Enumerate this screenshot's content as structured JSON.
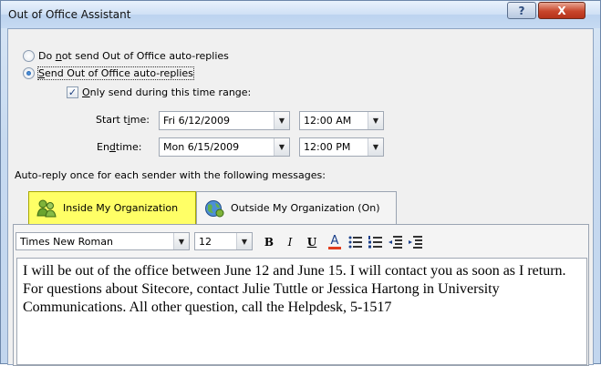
{
  "window": {
    "title": "Out of Office Assistant",
    "help_label": "?",
    "close_label": "X"
  },
  "options": {
    "do_not_send": {
      "pre": "Do ",
      "hot": "n",
      "post": "ot send Out of Office auto-replies",
      "selected": false
    },
    "send": {
      "pre": "",
      "hot": "S",
      "post": "end Out of Office auto-replies",
      "selected": true
    },
    "time_range": {
      "pre": "",
      "hot": "O",
      "post": "nly send during this time range:",
      "checked": true
    }
  },
  "start": {
    "label_pre": "Start t",
    "label_hot": "i",
    "label_post": "me:",
    "date": "Fri 6/12/2009",
    "time": "12:00 AM"
  },
  "end": {
    "label_pre": "En",
    "label_hot": "d",
    "label_post": " time:",
    "date": "Mon 6/15/2009",
    "time": "12:00 PM"
  },
  "autoreply_label": "Auto-reply once for each sender with the following messages:",
  "tabs": [
    {
      "label": "Inside My Organization",
      "active": true
    },
    {
      "label": "Outside My Organization (On)",
      "active": false
    }
  ],
  "toolbar": {
    "font": "Times New Roman",
    "size": "12",
    "bold": "B",
    "italic": "I",
    "underline": "U",
    "font_color": "A"
  },
  "message": "I will be out of the office between June 12 and June 15. I will contact you as soon as I return.  For questions about Sitecore, contact Julie Tuttle or Jessica Hartong in University Communications.  All other question, call the Helpdesk, 5-1517",
  "colors": {
    "active_tab": "#ffff66",
    "font_color_bar": "#e03c1e"
  }
}
